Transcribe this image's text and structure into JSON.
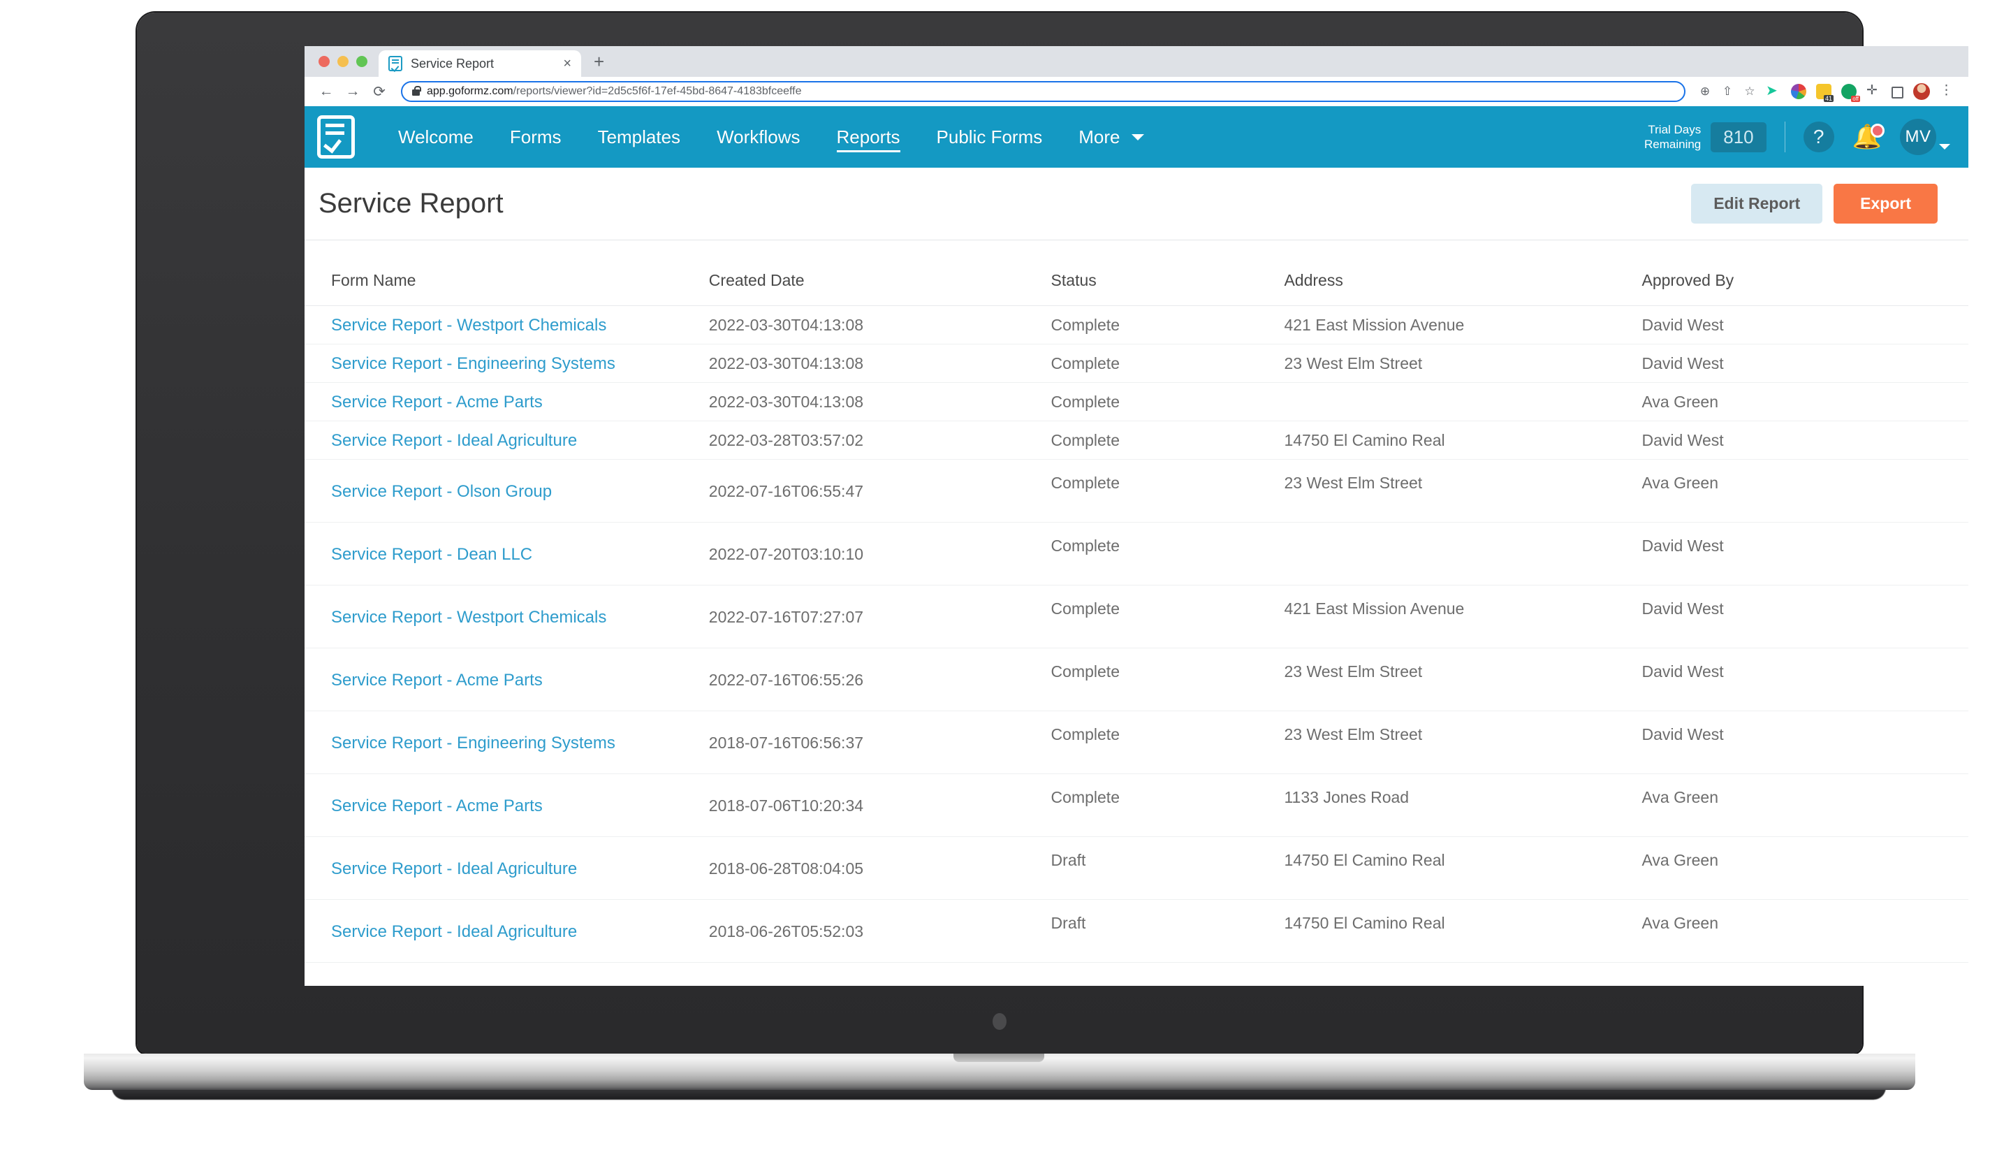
{
  "browser": {
    "tab_title": "Service Report",
    "tab_favicon_icon": "form-checklist-icon",
    "tab_close_label": "×",
    "new_tab_label": "+",
    "back_label": "←",
    "forward_label": "→",
    "reload_label": "⟳",
    "url_domain": "app.goformz.com",
    "url_path": "/reports/viewer?id=2d5c5f6f-17ef-45bd-8647-4183bfceeffe",
    "zoom_icon": "⊕",
    "share_icon": "⇧",
    "bookmark_icon": "☆",
    "puzzle_icon": "✛",
    "menu_icon": "⋮"
  },
  "appnav": {
    "logo_icon": "goformz-logo-icon",
    "links": [
      {
        "label": "Welcome",
        "active": false
      },
      {
        "label": "Forms",
        "active": false
      },
      {
        "label": "Templates",
        "active": false
      },
      {
        "label": "Workflows",
        "active": false
      },
      {
        "label": "Reports",
        "active": true
      },
      {
        "label": "Public Forms",
        "active": false
      },
      {
        "label": "More",
        "active": false,
        "has_caret": true
      }
    ],
    "trial_label_line1": "Trial Days",
    "trial_label_line2": "Remaining",
    "trial_days": "810",
    "help_icon": "?",
    "bell_icon": "🔔",
    "avatar_initials": "MV",
    "accent_blue": "#1499c3",
    "badge_blue": "#167d9e"
  },
  "header": {
    "title": "Service Report",
    "edit_report_label": "Edit Report",
    "export_label": "Export",
    "export_color": "#f97745",
    "edit_color": "#d7e9f2"
  },
  "table": {
    "columns": [
      "Form Name",
      "Created Date",
      "Status",
      "Address",
      "Approved By"
    ],
    "rows": [
      {
        "name": "Service Report - Westport Chemicals",
        "date": "2022-03-30T04:13:08",
        "status": "Complete",
        "address": "421 East Mission Avenue",
        "approved_by": "David West",
        "tall": false
      },
      {
        "name": "Service Report - Engineering Systems",
        "date": "2022-03-30T04:13:08",
        "status": "Complete",
        "address": "23 West Elm Street",
        "approved_by": "David West",
        "tall": false
      },
      {
        "name": "Service Report - Acme Parts",
        "date": "2022-03-30T04:13:08",
        "status": "Complete",
        "address": "",
        "approved_by": "Ava Green",
        "tall": false
      },
      {
        "name": "Service Report - Ideal Agriculture",
        "date": "2022-03-28T03:57:02",
        "status": "Complete",
        "address": "14750 El Camino Real",
        "approved_by": "David West",
        "tall": false
      },
      {
        "name": "Service Report - Olson Group",
        "date": "2022-07-16T06:55:47",
        "status": "Complete",
        "address": "23 West Elm Street",
        "approved_by": "Ava Green",
        "tall": true
      },
      {
        "name": "Service Report - Dean LLC",
        "date": "2022-07-20T03:10:10",
        "status": "Complete",
        "address": "",
        "approved_by": "David West",
        "tall": true
      },
      {
        "name": "Service Report - Westport Chemicals",
        "date": "2022-07-16T07:27:07",
        "status": "Complete",
        "address": "421 East Mission Avenue",
        "approved_by": "David West",
        "tall": true
      },
      {
        "name": "Service Report - Acme Parts",
        "date": "2022-07-16T06:55:26",
        "status": "Complete",
        "address": "23 West Elm Street",
        "approved_by": "David West",
        "tall": true
      },
      {
        "name": "Service Report - Engineering Systems",
        "date": "2018-07-16T06:56:37",
        "status": "Complete",
        "address": "23 West Elm Street",
        "approved_by": "David West",
        "tall": true
      },
      {
        "name": "Service Report - Acme Parts",
        "date": "2018-07-06T10:20:34",
        "status": "Complete",
        "address": "1133 Jones Road",
        "approved_by": "Ava Green",
        "tall": true
      },
      {
        "name": "Service Report - Ideal Agriculture",
        "date": "2018-06-28T08:04:05",
        "status": "Draft",
        "address": "14750 El Camino Real",
        "approved_by": "Ava Green",
        "tall": true
      },
      {
        "name": "Service Report - Ideal Agriculture",
        "date": "2018-06-26T05:52:03",
        "status": "Draft",
        "address": "14750 El Camino Real",
        "approved_by": "Ava Green",
        "tall": true
      }
    ]
  }
}
